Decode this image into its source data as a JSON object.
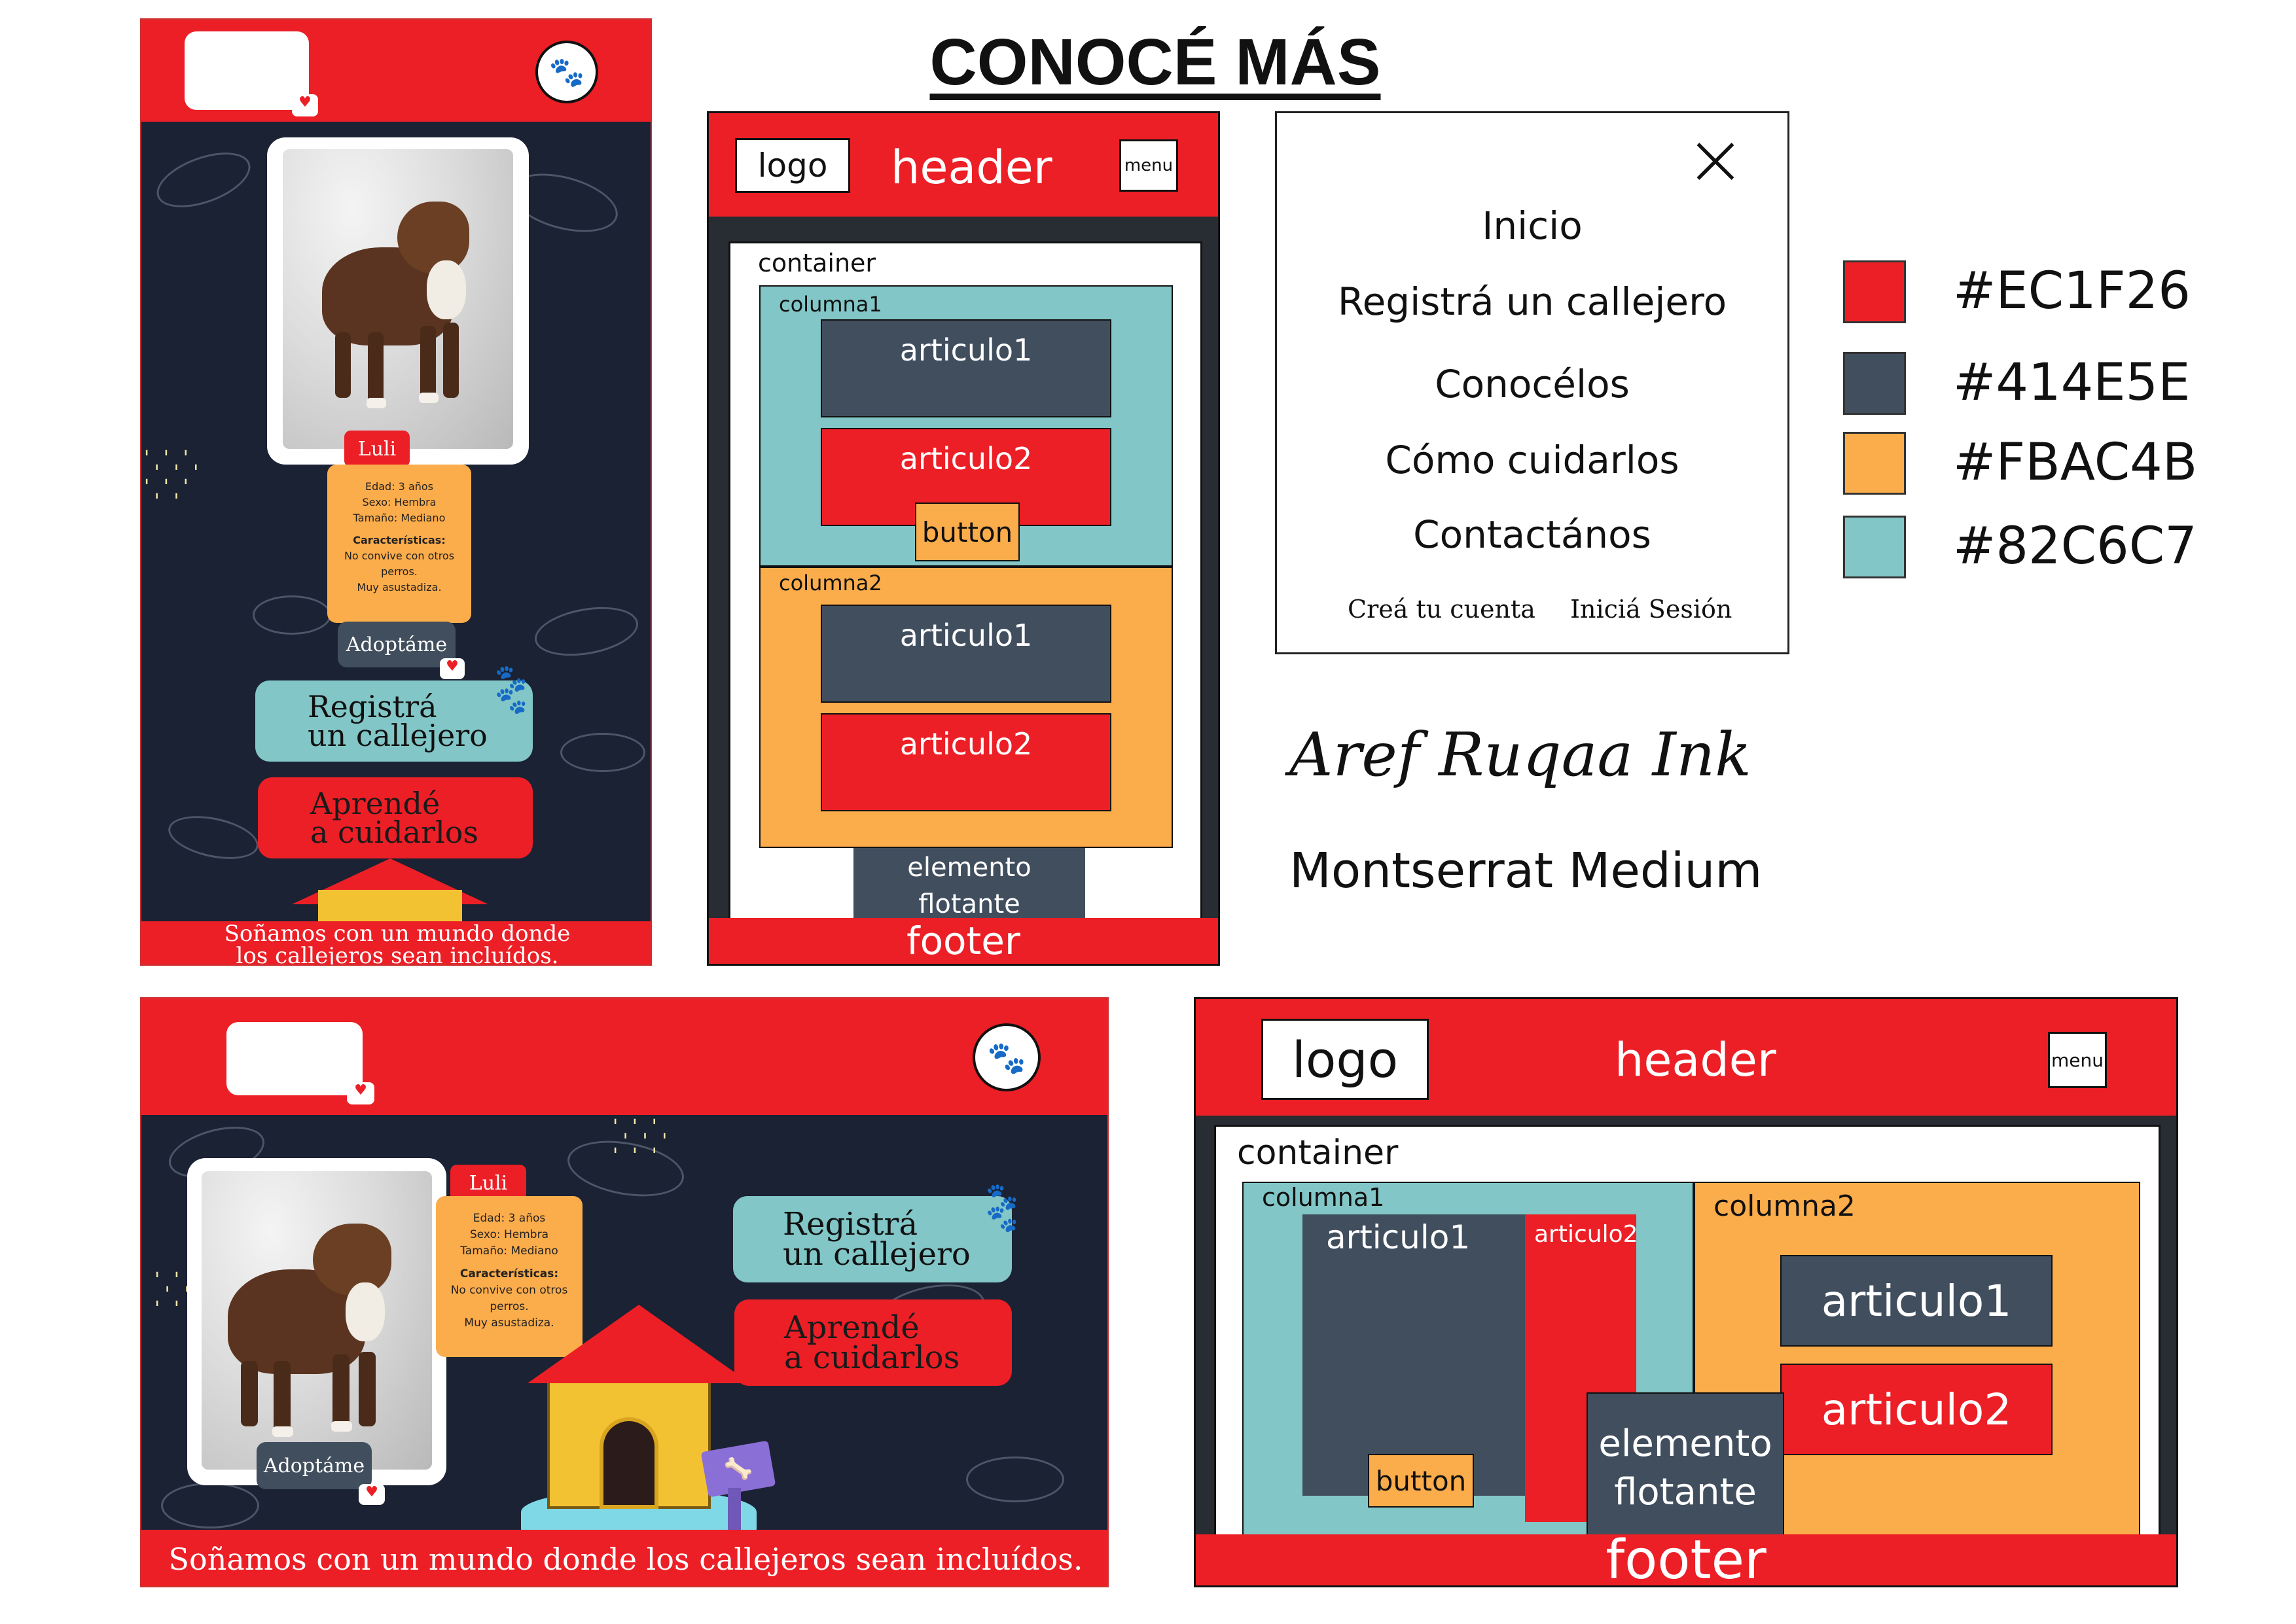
{
  "title": "CONOCÉ MÁS",
  "mobile_mockup": {
    "dog_name": "Luli",
    "info_lines": [
      "Edad: 3 años",
      "Sexo: Hembra",
      "Tamaño: Mediano"
    ],
    "features_title": "Características:",
    "features_lines": [
      "No convive con otros",
      "perros.",
      "Muy asustadiza."
    ],
    "adopt_label": "Adoptáme",
    "register_line1": "Registrá",
    "register_line2": "un callejero",
    "learn_line1": "Aprendé",
    "learn_line2": "a cuidarlos",
    "footer_line1": "Soñamos con un mundo donde",
    "footer_line2": "los callejeros sean incluídos."
  },
  "mobile_wireframe": {
    "logo": "logo",
    "header": "header",
    "menu": "menu",
    "container": "container",
    "columna1": "columna1",
    "articulo1": "articulo1",
    "articulo2": "articulo2",
    "button": "button",
    "columna2": "columna2",
    "floating_line1": "elemento",
    "floating_line2": "flotante",
    "footer": "footer"
  },
  "menu_panel": {
    "close_icon": "close-icon",
    "items": [
      "Inicio",
      "Registrá un callejero",
      "Conocélos",
      "Cómo cuidarlos",
      "Contactános"
    ],
    "create_account": "Creá tu cuenta",
    "login": "Iniciá Sesión"
  },
  "palette": {
    "colors": [
      "#EC1F26",
      "#414E5E",
      "#FBAC4B",
      "#82C6C7"
    ],
    "labels": [
      "#EC1F26",
      "#414E5E",
      "#FBAC4B",
      "#82C6C7"
    ]
  },
  "fonts": {
    "display_label": "Aref Ruqaa Ink",
    "body_label": "Montserrat Medium"
  },
  "desktop_mockup": {
    "dog_name": "Luli",
    "info_lines": [
      "Edad: 3 años",
      "Sexo: Hembra",
      "Tamaño: Mediano"
    ],
    "features_title": "Características:",
    "features_lines": [
      "No convive con otros",
      "perros.",
      "Muy asustadiza."
    ],
    "adopt_label": "Adoptáme",
    "register_line1": "Registrá",
    "register_line2": "un callejero",
    "learn_line1": "Aprendé",
    "learn_line2": "a cuidarlos",
    "footer": "Soñamos con un mundo donde los callejeros sean incluídos."
  },
  "desktop_wireframe": {
    "logo": "logo",
    "header": "header",
    "menu": "menu",
    "container": "container",
    "columna1": "columna1",
    "articulo1": "articulo1",
    "articulo2": "articulo2",
    "button": "button",
    "columna2": "columna2",
    "col2_articulo1": "articulo1",
    "col2_articulo2": "articulo2",
    "floating_line1": "elemento",
    "floating_line2": "flotante",
    "footer": "footer"
  }
}
